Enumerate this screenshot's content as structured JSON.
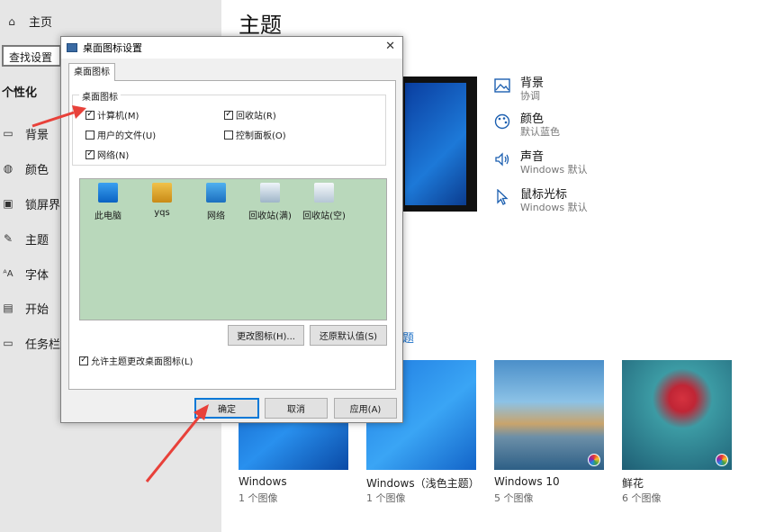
{
  "nav": {
    "home": "主页",
    "search_placeholder": "查找设置",
    "section": "个性化",
    "items": [
      {
        "label": "背景",
        "icon": "picture-icon"
      },
      {
        "label": "颜色",
        "icon": "palette-icon"
      },
      {
        "label": "锁屏界面",
        "icon": "lock-screen-icon"
      },
      {
        "label": "主题",
        "icon": "theme-icon"
      },
      {
        "label": "字体",
        "icon": "font-icon"
      },
      {
        "label": "开始",
        "icon": "start-icon"
      },
      {
        "label": "任务栏",
        "icon": "taskbar-icon"
      }
    ]
  },
  "main": {
    "title": "主题",
    "options": [
      {
        "title": "背景",
        "sub": "协调",
        "icon": "picture-icon"
      },
      {
        "title": "颜色",
        "sub": "默认蓝色",
        "icon": "palette-icon"
      },
      {
        "title": "声音",
        "sub": "Windows 默认",
        "icon": "speaker-icon"
      },
      {
        "title": "鼠标光标",
        "sub": "Windows 默认",
        "icon": "cursor-icon"
      }
    ],
    "link_tail": "题",
    "themes": [
      {
        "name": "Windows",
        "count": "1 个图像"
      },
      {
        "name": "Windows（浅色主题）",
        "count": "1 个图像"
      },
      {
        "name": "Windows 10",
        "count": "5 个图像"
      },
      {
        "name": "鲜花",
        "count": "6 个图像"
      }
    ]
  },
  "dialog": {
    "title": "桌面图标设置",
    "tab": "桌面图标",
    "group_label": "桌面图标",
    "checkboxes": [
      {
        "label": "计算机(M)",
        "checked": true
      },
      {
        "label": "回收站(R)",
        "checked": true
      },
      {
        "label": "用户的文件(U)",
        "checked": false
      },
      {
        "label": "控制面板(O)",
        "checked": false
      },
      {
        "label": "网络(N)",
        "checked": true
      }
    ],
    "icons": [
      "此电脑",
      "yqs",
      "网络",
      "回收站(满)",
      "回收站(空)"
    ],
    "change_icon": "更改图标(H)...",
    "restore_default": "还原默认值(S)",
    "allow_themes": "允许主题更改桌面图标(L)",
    "allow_checked": true,
    "ok": "确定",
    "cancel": "取消",
    "apply": "应用(A)"
  },
  "colors": {
    "annotation_arrow": "#e8413a",
    "icon_area": "#b9d8bb",
    "accent": "#0078d7"
  }
}
